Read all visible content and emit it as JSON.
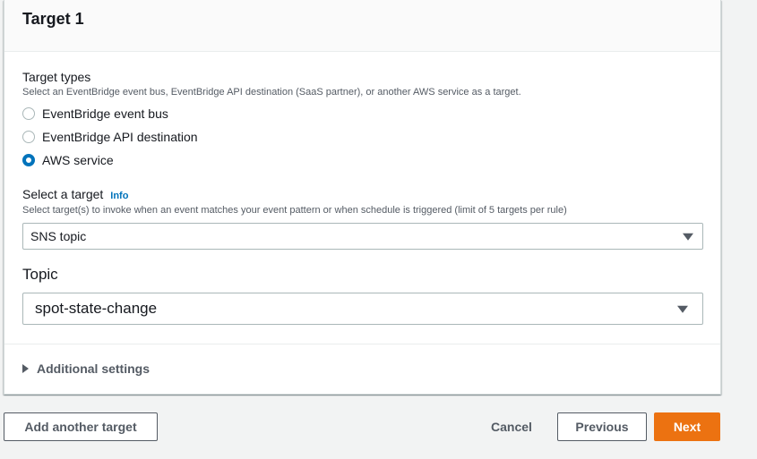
{
  "target": {
    "title": "Target 1",
    "types": {
      "label": "Target types",
      "description": "Select an EventBridge event bus, EventBridge API destination (SaaS partner), or another AWS service as a target.",
      "options": [
        {
          "label": "EventBridge event bus",
          "checked": false
        },
        {
          "label": "EventBridge API destination",
          "checked": false
        },
        {
          "label": "AWS service",
          "checked": true
        }
      ]
    },
    "select_target": {
      "label": "Select a target",
      "info": "Info",
      "description": "Select target(s) to invoke when an event matches your event pattern or when schedule is triggered (limit of 5 targets per rule)",
      "value": "SNS topic"
    },
    "topic": {
      "label": "Topic",
      "value": "spot-state-change"
    },
    "additional_settings": "Additional settings"
  },
  "footer": {
    "add_target": "Add another target",
    "cancel": "Cancel",
    "previous": "Previous",
    "next": "Next"
  },
  "colors": {
    "accent": "#0073bb",
    "primary_button": "#ec7211"
  }
}
